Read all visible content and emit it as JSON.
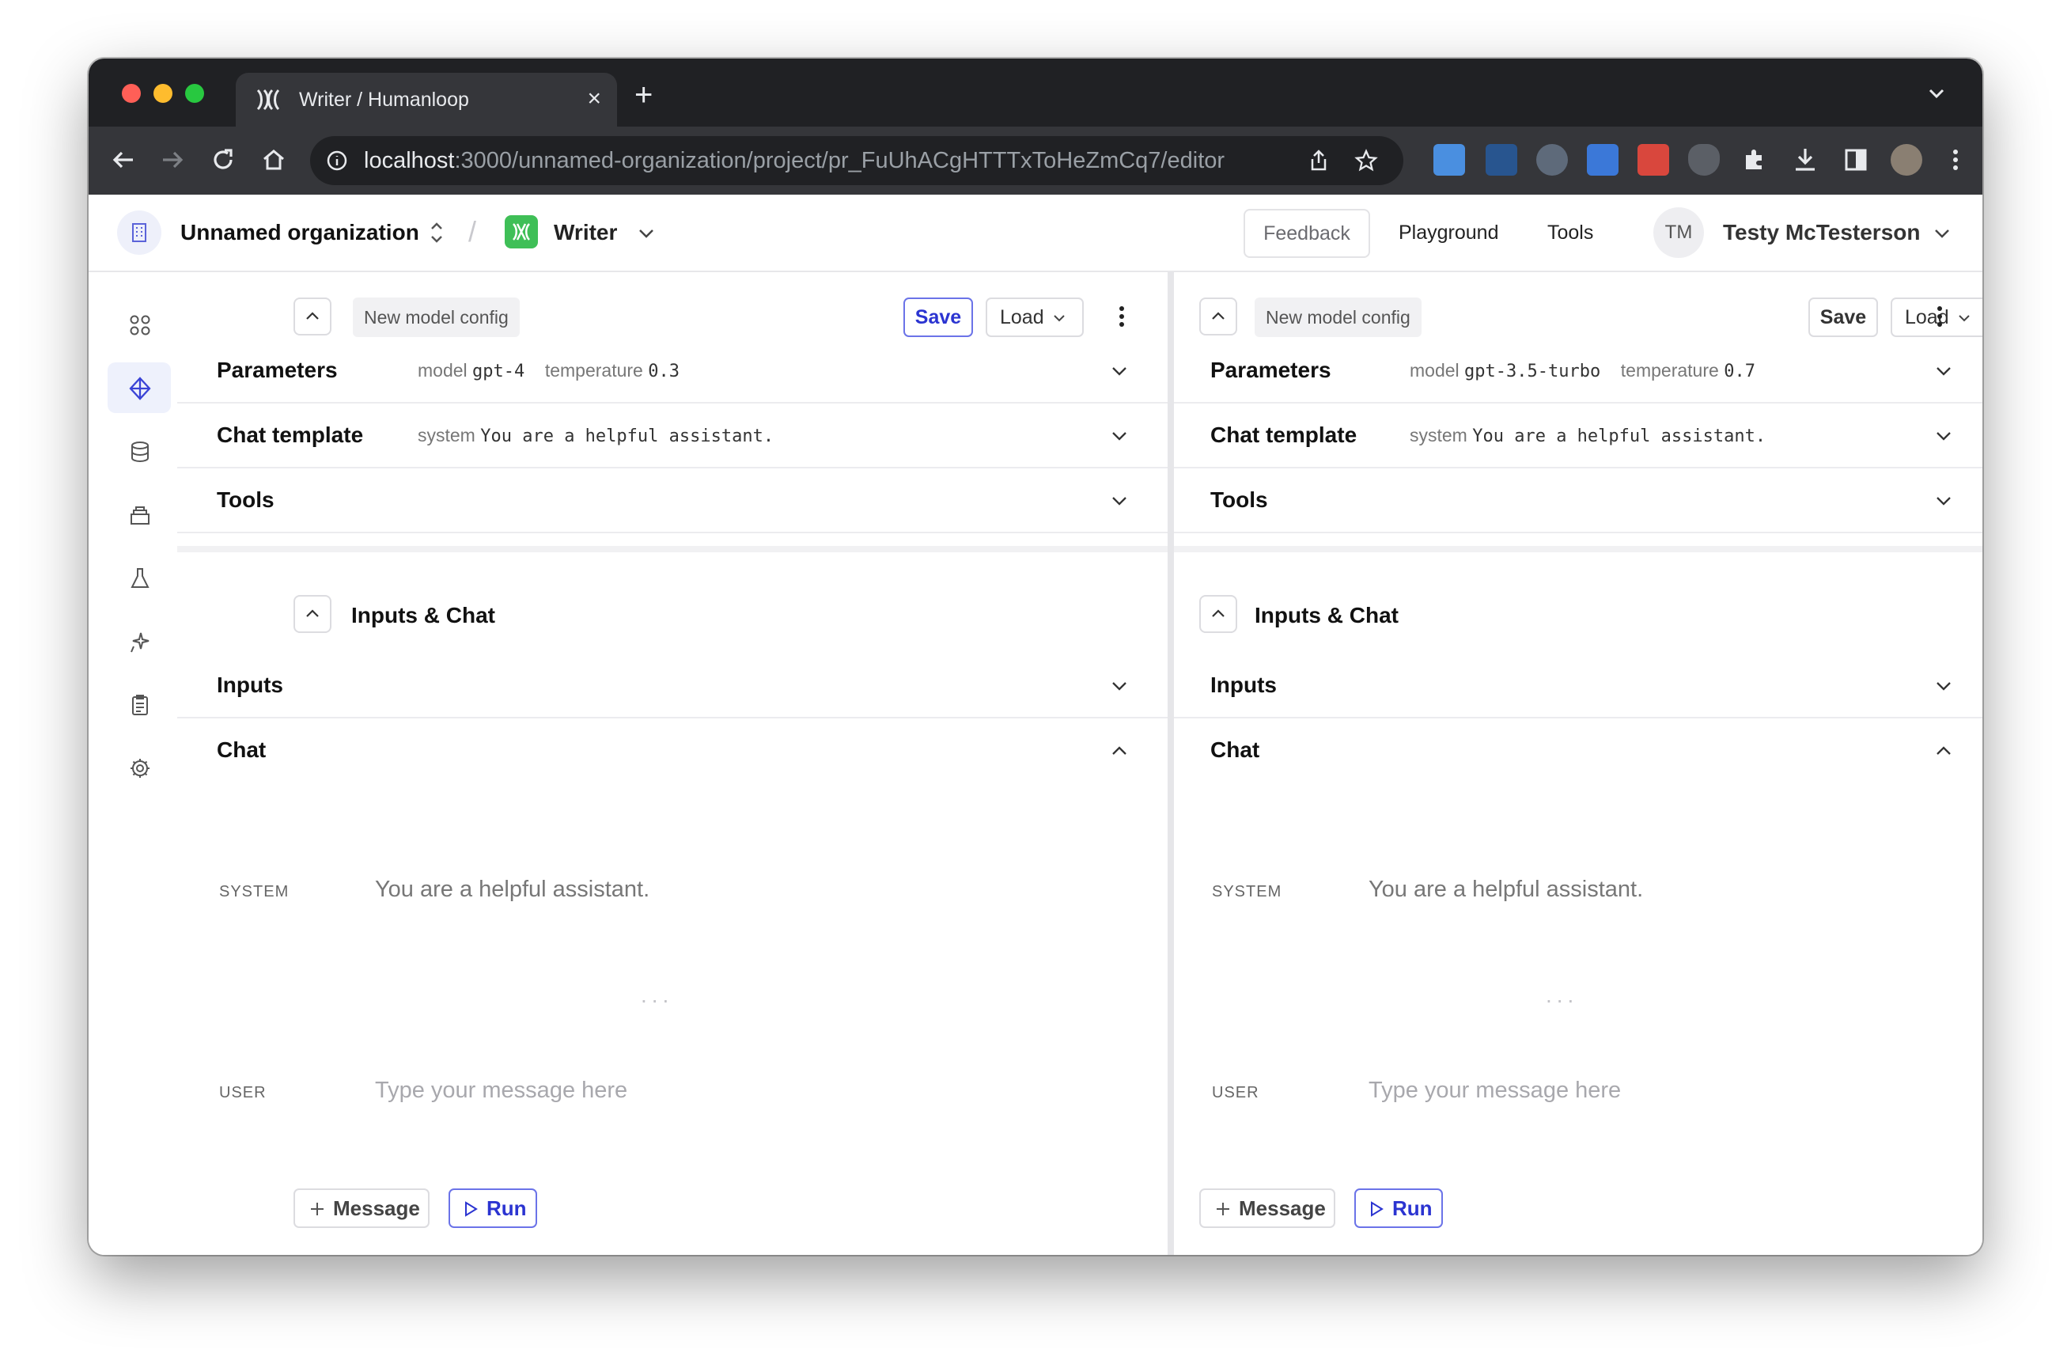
{
  "browser": {
    "tab_title": "Writer / Humanloop",
    "url_host": "localhost",
    "url_path": ":3000/unnamed-organization/project/pr_FuUhACgHTTTxToHeZmCq7/editor"
  },
  "header": {
    "organization": "Unnamed organization",
    "separator": "/",
    "project": "Writer",
    "feedback": "Feedback",
    "playground": "Playground",
    "tools": "Tools",
    "user_initials": "TM",
    "user_name": "Testy McTesterson"
  },
  "panes": [
    {
      "config_chip": "New model config",
      "save": "Save",
      "load": "Load",
      "parameters_label": "Parameters",
      "model_key": "model",
      "model_value": "gpt-4",
      "temperature_key": "temperature",
      "temperature_value": "0.3",
      "chat_template_label": "Chat template",
      "system_key": "system",
      "system_value": "You are a helpful assistant.",
      "tools_label": "Tools",
      "inputs_chat_title": "Inputs & Chat",
      "inputs_label": "Inputs",
      "chat_label": "Chat",
      "system_role": "SYSTEM",
      "system_message": "You are a helpful assistant.",
      "ellipsis": "...",
      "user_role": "USER",
      "user_placeholder": "Type your message here",
      "message_button": "Message",
      "run_button": "Run"
    },
    {
      "config_chip": "New model config",
      "save": "Save",
      "load": "Load",
      "parameters_label": "Parameters",
      "model_key": "model",
      "model_value": "gpt-3.5-turbo",
      "temperature_key": "temperature",
      "temperature_value": "0.7",
      "chat_template_label": "Chat template",
      "system_key": "system",
      "system_value": "You are a helpful assistant.",
      "tools_label": "Tools",
      "inputs_chat_title": "Inputs & Chat",
      "inputs_label": "Inputs",
      "chat_label": "Chat",
      "system_role": "SYSTEM",
      "system_message": "You are a helpful assistant.",
      "ellipsis": "...",
      "user_role": "USER",
      "user_placeholder": "Type your message here",
      "message_button": "Message",
      "run_button": "Run"
    }
  ],
  "sidebar": {
    "items": [
      "dashboard-icon",
      "editor-icon",
      "data-icon",
      "datasets-icon",
      "evaluations-icon",
      "fine-tune-icon",
      "logs-icon",
      "settings-icon"
    ],
    "active": "editor-icon"
  },
  "colors": {
    "accent": "#2b34d1",
    "accent_border": "#6b73e8",
    "project_icon": "#3fbf57",
    "chrome_dark": "#202124",
    "chrome_toolbar": "#35363a"
  }
}
